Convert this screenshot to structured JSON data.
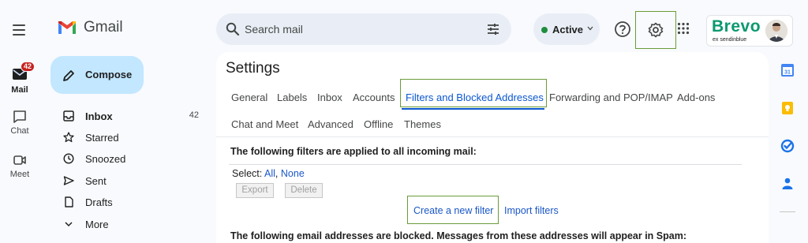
{
  "header": {
    "app_name": "Gmail",
    "search_placeholder": "Search mail",
    "status_label": "Active",
    "brand": {
      "name": "Brevo",
      "sub": "ex sendinblue",
      "color": "#0b996e"
    },
    "icons": [
      "menu-icon",
      "gmail-logo",
      "search-icon",
      "search-options-icon",
      "chevron-down-icon",
      "help-icon",
      "gear-icon",
      "apps-grid-icon",
      "avatar"
    ]
  },
  "rail": {
    "items": [
      {
        "label": "Mail",
        "icon": "mail-icon",
        "badge": "42"
      },
      {
        "label": "Chat",
        "icon": "chat-icon"
      },
      {
        "label": "Meet",
        "icon": "video-icon"
      }
    ]
  },
  "compose": {
    "label": "Compose"
  },
  "nav": {
    "items": [
      {
        "label": "Inbox",
        "count": "42",
        "icon": "inbox-icon"
      },
      {
        "label": "Starred",
        "icon": "star-icon"
      },
      {
        "label": "Snoozed",
        "icon": "clock-icon"
      },
      {
        "label": "Sent",
        "icon": "send-icon"
      },
      {
        "label": "Drafts",
        "icon": "draft-icon"
      },
      {
        "label": "More",
        "icon": "chevron-down-icon"
      }
    ]
  },
  "settings": {
    "title": "Settings",
    "tabs_row1": [
      "General",
      "Labels",
      "Inbox",
      "Accounts",
      "Filters and Blocked Addresses",
      "Forwarding and POP/IMAP",
      "Add-ons"
    ],
    "tabs_row2": [
      "Chat and Meet",
      "Advanced",
      "Offline",
      "Themes"
    ],
    "active_tab": "Filters and Blocked Addresses",
    "filters_heading": "The following filters are applied to all incoming mail:",
    "select_label": "Select:",
    "select_all": "All",
    "select_sep": ",",
    "select_none": "None",
    "export_label": "Export",
    "delete_label": "Delete",
    "create_filter_link": "Create a new filter",
    "import_filters_link": "Import filters",
    "blocked_heading_partial": "The following email addresses are blocked. Messages from these addresses will appear in Spam:"
  },
  "right_rail": {
    "icons": [
      "calendar-icon",
      "keep-icon",
      "tasks-icon",
      "contacts-icon"
    ]
  },
  "colors": {
    "accent": "#0b57d0",
    "compose_bg": "#c2e7ff",
    "highlight_box": "#6a9c3a",
    "badge": "#c5221f"
  }
}
